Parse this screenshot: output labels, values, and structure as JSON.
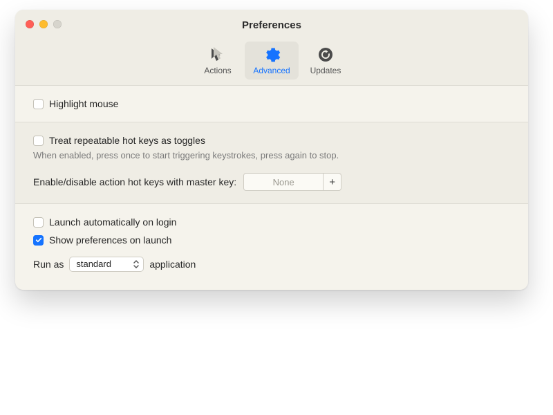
{
  "window": {
    "title": "Preferences"
  },
  "tabs": {
    "actions": {
      "label": "Actions"
    },
    "advanced": {
      "label": "Advanced"
    },
    "updates": {
      "label": "Updates"
    }
  },
  "section_highlight": {
    "highlight_mouse": {
      "label": "Highlight mouse",
      "checked": false
    }
  },
  "section_hotkeys": {
    "treat_toggles": {
      "label": "Treat repeatable hot keys as toggles",
      "checked": false
    },
    "treat_toggles_hint": "When enabled, press once to start triggering keystrokes, press again to stop.",
    "master_key_label": "Enable/disable action hot keys with master key:",
    "master_key_value": "None",
    "master_key_plus": "+"
  },
  "section_launch": {
    "launch_login": {
      "label": "Launch automatically on login",
      "checked": false
    },
    "show_prefs": {
      "label": "Show preferences on launch",
      "checked": true
    },
    "run_as_prefix": "Run as",
    "run_as_value": "standard",
    "run_as_suffix": "application"
  }
}
